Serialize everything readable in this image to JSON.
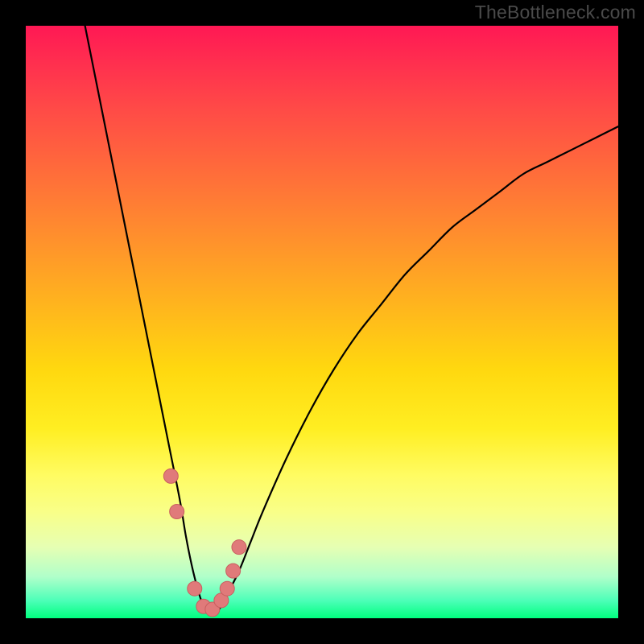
{
  "watermark": "TheBottleneck.com",
  "colors": {
    "background": "#000000",
    "gradient_top": "#ff1854",
    "gradient_mid": "#ffee22",
    "gradient_bottom": "#00ff7f",
    "curve": "#000000",
    "marker_fill": "#e07a7a",
    "marker_stroke": "#c85f5f"
  },
  "chart_data": {
    "type": "line",
    "title": "",
    "xlabel": "",
    "ylabel": "",
    "xlim": [
      0,
      100
    ],
    "ylim": [
      0,
      100
    ],
    "grid": false,
    "series": [
      {
        "name": "bottleneck-curve",
        "x": [
          10,
          12,
          14,
          16,
          18,
          20,
          22,
          24,
          26,
          27,
          28,
          29,
          30,
          31,
          32,
          33,
          34,
          36,
          38,
          40,
          44,
          48,
          52,
          56,
          60,
          64,
          68,
          72,
          76,
          80,
          84,
          88,
          92,
          96,
          100
        ],
        "values": [
          100,
          90,
          80,
          70,
          60,
          50,
          40,
          30,
          20,
          14,
          9,
          5,
          2,
          1,
          1,
          2,
          4,
          8,
          13,
          18,
          27,
          35,
          42,
          48,
          53,
          58,
          62,
          66,
          69,
          72,
          75,
          77,
          79,
          81,
          83
        ]
      }
    ],
    "markers": {
      "name": "highlight-points",
      "x": [
        24.5,
        25.5,
        28.5,
        30.0,
        31.5,
        33.0,
        34.0,
        35.0,
        36.0
      ],
      "values": [
        24.0,
        18.0,
        5.0,
        2.0,
        1.5,
        3.0,
        5.0,
        8.0,
        12.0
      ],
      "r": 9
    }
  }
}
